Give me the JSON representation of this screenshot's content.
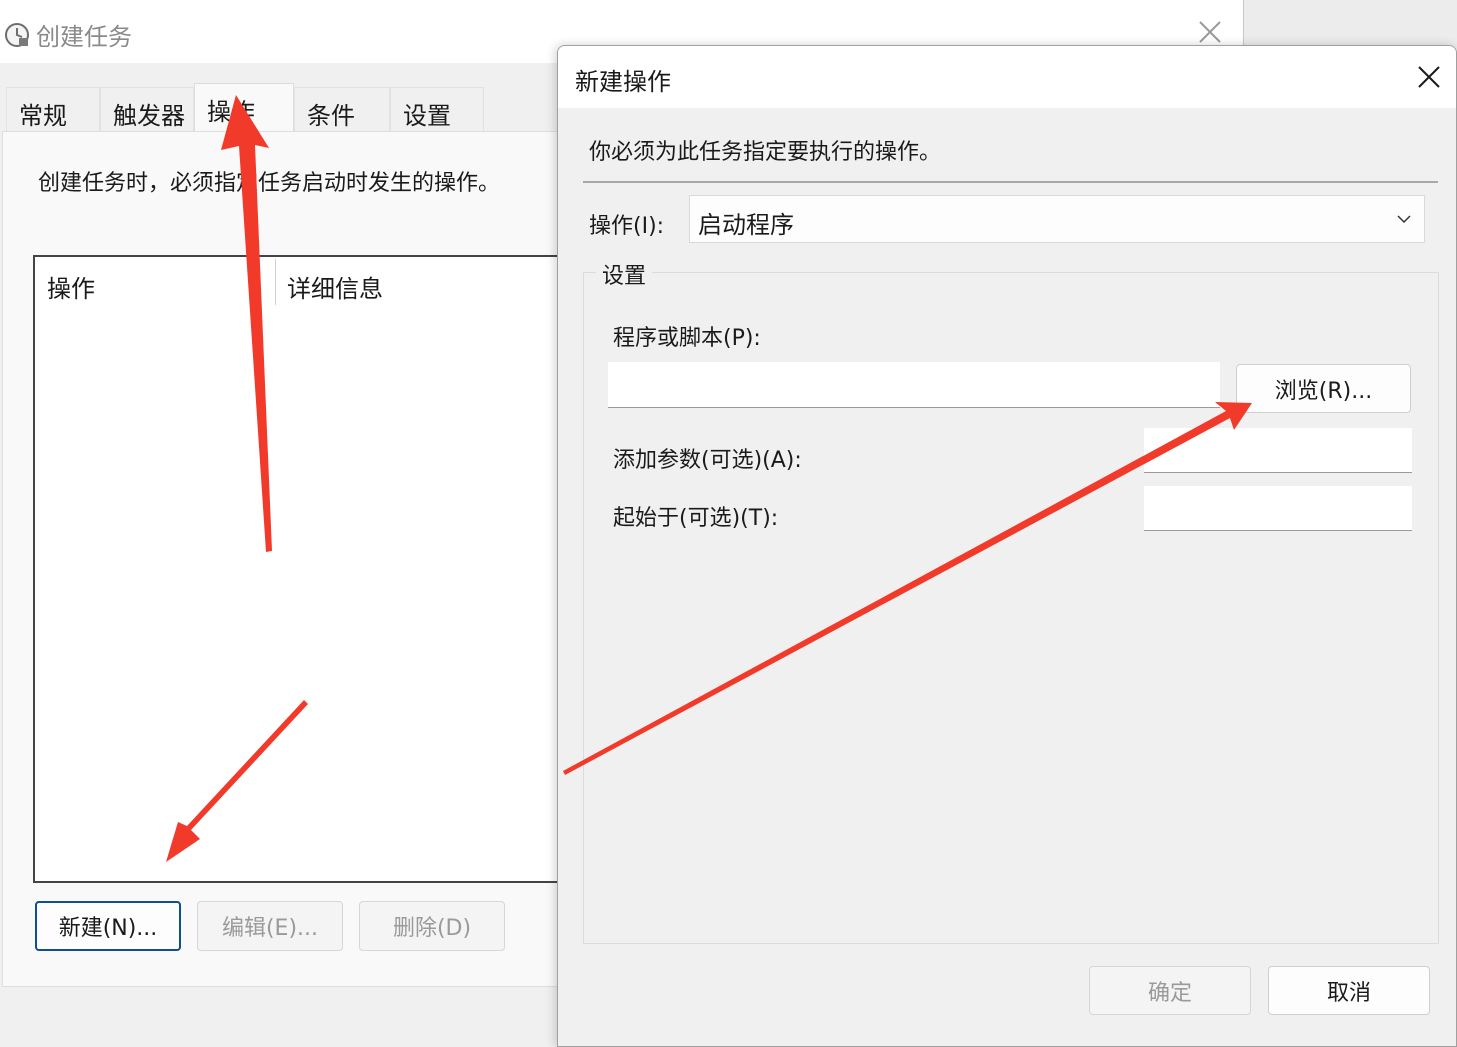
{
  "background_dialog": {
    "title": "创建任务",
    "tabs": [
      {
        "label": "常规"
      },
      {
        "label": "触发器"
      },
      {
        "label": "操作"
      },
      {
        "label": "条件"
      },
      {
        "label": "设置"
      }
    ],
    "active_tab": "操作",
    "description": "创建任务时，必须指定任务启动时发生的操作。",
    "list_columns": [
      "操作",
      "详细信息"
    ],
    "buttons": {
      "new": "新建(N)...",
      "edit": "编辑(E)...",
      "delete": "删除(D)"
    }
  },
  "new_action_dialog": {
    "title": "新建操作",
    "instruction": "你必须为此任务指定要执行的操作。",
    "action_label": "操作(I):",
    "action_value": "启动程序",
    "settings_group": "设置",
    "program_label": "程序或脚本(P):",
    "program_value": "",
    "browse_button": "浏览(R)...",
    "args_label": "添加参数(可选)(A):",
    "args_value": "",
    "start_label": "起始于(可选)(T):",
    "start_value": "",
    "ok_button": "确定",
    "cancel_button": "取消"
  },
  "annotation": {
    "arrow_color": "#f23a2a"
  }
}
